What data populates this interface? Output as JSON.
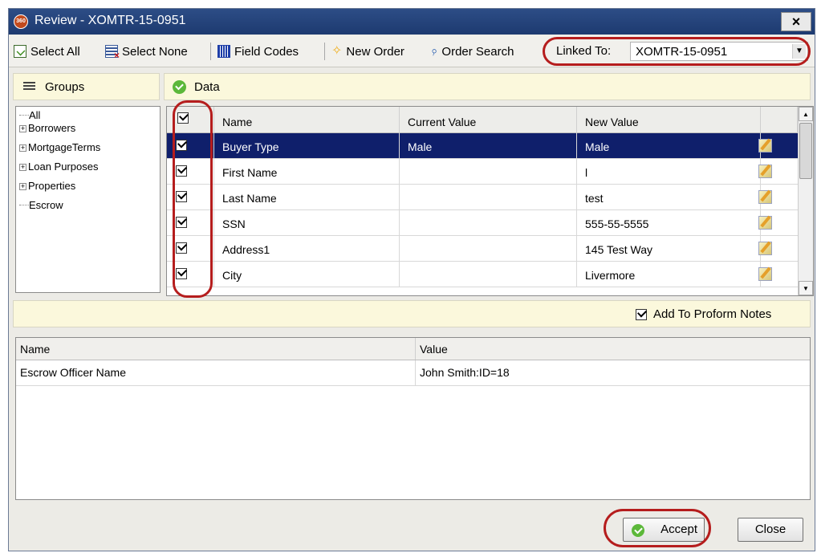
{
  "window": {
    "title": "Review - XOMTR-15-0951",
    "app_icon": "360",
    "close": "×"
  },
  "toolbar": {
    "select_all": "Select All",
    "select_none": "Select None",
    "field_codes": "Field Codes",
    "new_order": "New Order",
    "order_search": "Order Search",
    "linked_to_label": "Linked To:",
    "linked_to_value": "XOMTR-15-0951"
  },
  "groups": {
    "header": "Groups",
    "items": [
      "All",
      "Borrowers",
      "MortgageTerms",
      "Loan Purposes",
      "Properties",
      "Escrow"
    ]
  },
  "data": {
    "header": "Data",
    "columns": [
      "Name",
      "Current Value",
      "New Value"
    ],
    "rows": [
      {
        "name": "Buyer Type",
        "current": "Male",
        "new": "Male",
        "checked": true,
        "selected": true
      },
      {
        "name": "First Name",
        "current": "",
        "new": "l",
        "checked": true
      },
      {
        "name": "Last Name",
        "current": "",
        "new": "test",
        "checked": true
      },
      {
        "name": "SSN",
        "current": "",
        "new": "555-55-5555",
        "checked": true
      },
      {
        "name": "Address1",
        "current": "",
        "new": "145 Test Way",
        "checked": true
      },
      {
        "name": "City",
        "current": "",
        "new": "Livermore",
        "checked": true
      }
    ]
  },
  "notes": {
    "add_to_proform": "Add To Proform Notes",
    "checked": true
  },
  "details": {
    "columns": [
      "Name",
      "Value"
    ],
    "rows": [
      {
        "name": "Escrow Officer Name",
        "value": "John Smith:ID=18"
      }
    ]
  },
  "buttons": {
    "accept": "Accept",
    "close": "Close"
  },
  "colors": {
    "title_bar": "#1d3a70",
    "selected_row": "#0f1f6b",
    "header_bg": "#fbf8dc",
    "highlight": "#b51d1d"
  }
}
